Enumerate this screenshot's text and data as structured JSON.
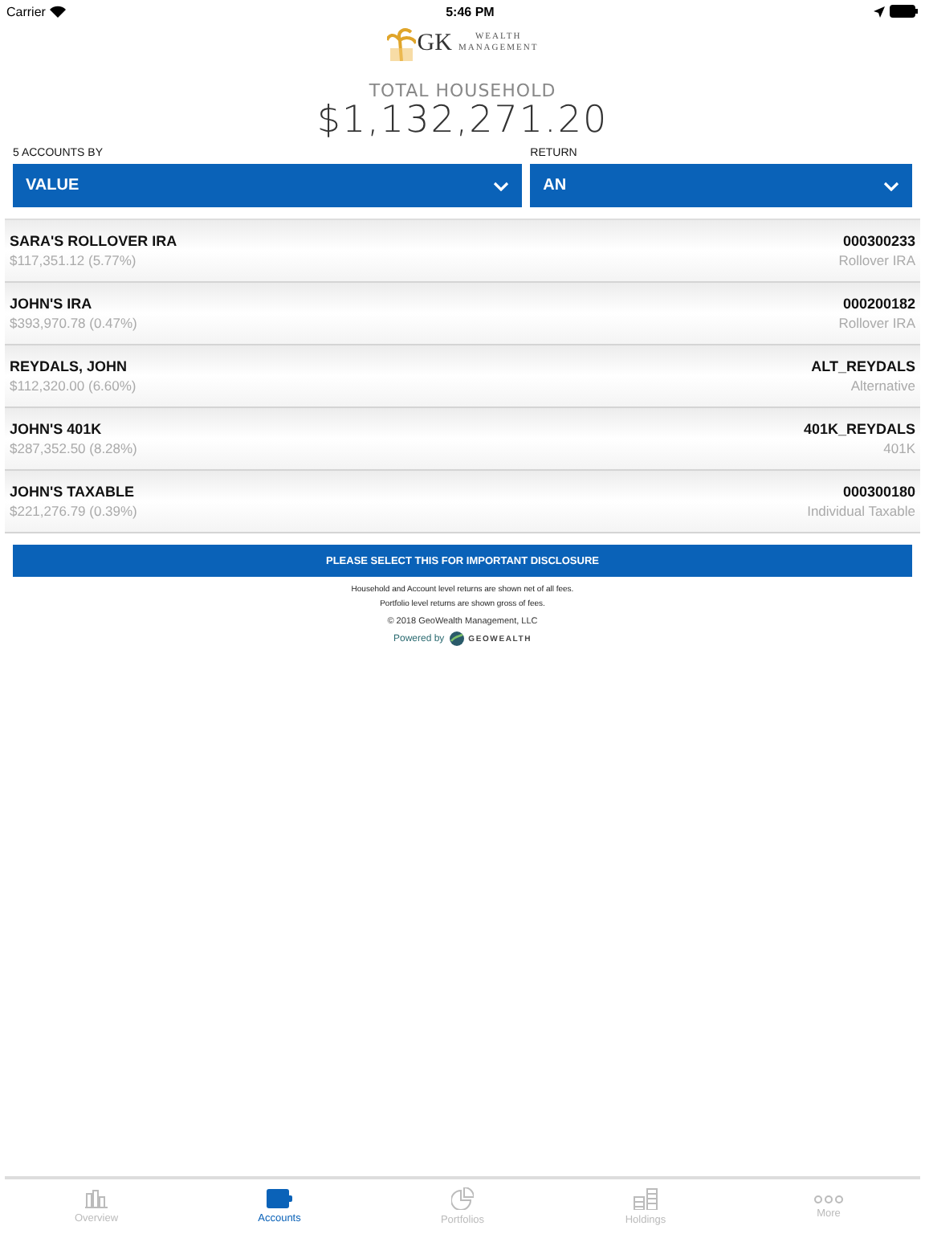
{
  "status_bar": {
    "carrier": "Carrier",
    "time": "5:46 PM"
  },
  "logo": {
    "mark": "GK",
    "line_1": "WEALTH",
    "line_2": "MANAGEMENT"
  },
  "total": {
    "label": "TOTAL HOUSEHOLD",
    "value": "$1,132,271.20"
  },
  "filters": [
    {
      "label": "5 ACCOUNTS BY",
      "value": "VALUE"
    },
    {
      "label": "RETURN",
      "value": "AN"
    }
  ],
  "accounts": [
    {
      "name": "SARA'S ROLLOVER IRA",
      "detail": "$117,351.12 (5.77%)",
      "number": "000300233",
      "type": "Rollover IRA"
    },
    {
      "name": "JOHN'S IRA",
      "detail": "$393,970.78 (0.47%)",
      "number": "000200182",
      "type": "Rollover IRA"
    },
    {
      "name": "REYDALS, JOHN",
      "detail": "$112,320.00 (6.60%)",
      "number": "ALT_REYDALS",
      "type": "Alternative"
    },
    {
      "name": "JOHN'S 401K",
      "detail": "$287,352.50 (8.28%)",
      "number": "401K_REYDALS",
      "type": "401K"
    },
    {
      "name": "JOHN'S TAXABLE",
      "detail": "$221,276.79 (0.39%)",
      "number": "000300180",
      "type": "Individual Taxable"
    }
  ],
  "disclosure_button": "PLEASE SELECT THIS FOR IMPORTANT DISCLOSURE",
  "notes": [
    "Household and Account level returns are shown net of all fees.",
    "Portfolio level returns are shown gross of fees."
  ],
  "copyright": "© 2018 GeoWealth Management, LLC",
  "powered_by": {
    "label": "Powered by",
    "brand": "GEOWEALTH"
  },
  "tabs": [
    {
      "label": "Overview",
      "selected": false
    },
    {
      "label": "Accounts",
      "selected": true
    },
    {
      "label": "Portfolios",
      "selected": false
    },
    {
      "label": "Holdings",
      "selected": false
    },
    {
      "label": "More",
      "selected": false
    }
  ]
}
